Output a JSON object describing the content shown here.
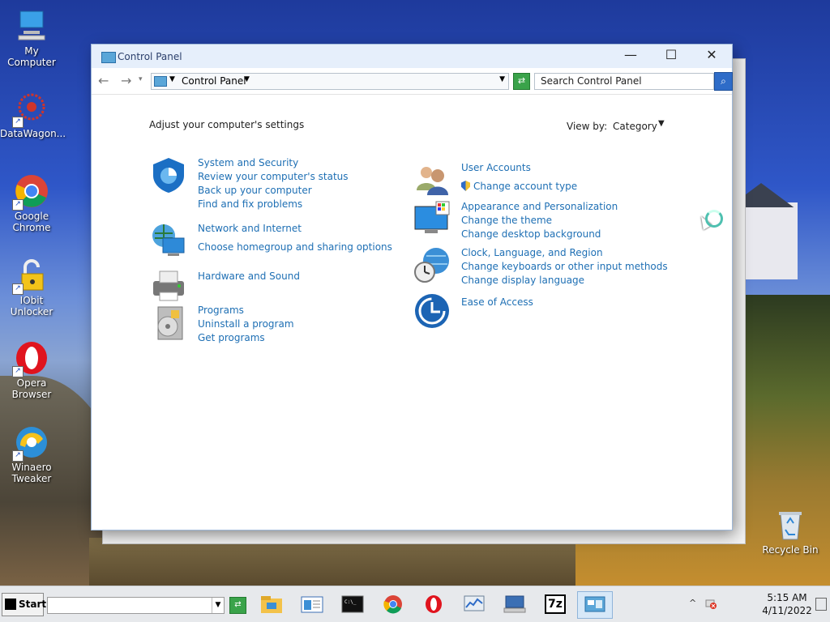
{
  "desktop": {
    "icons": [
      {
        "label": "My Computer",
        "icon": "computer-icon",
        "shortcut": false
      },
      {
        "label": "DataWagon...",
        "icon": "datawagon-icon",
        "shortcut": true
      },
      {
        "label": "Google Chrome",
        "icon": "chrome-icon",
        "shortcut": true
      },
      {
        "label": "IObit Unlocker",
        "icon": "lock-icon",
        "shortcut": true
      },
      {
        "label": "Opera Browser",
        "icon": "opera-icon",
        "shortcut": true
      },
      {
        "label": "Winaero Tweaker",
        "icon": "winaero-icon",
        "shortcut": true
      }
    ],
    "recycle_bin": "Recycle Bin"
  },
  "window": {
    "title": "Control Panel",
    "address": {
      "crumb": "Control Panel",
      "search_placeholder": "Search Control Panel"
    },
    "heading": "Adjust your computer's settings",
    "view_by_label": "View by:",
    "view_by_value": "Category",
    "categories_left": [
      {
        "title": "System and Security",
        "icon": "shield-icon",
        "links": [
          "Review your computer's status",
          "Back up your computer",
          "Find and fix problems"
        ]
      },
      {
        "title": "Network and Internet",
        "icon": "network-globe-icon",
        "links": [
          "Choose homegroup and sharing options"
        ]
      },
      {
        "title": "Hardware and Sound",
        "icon": "printer-icon",
        "links": []
      },
      {
        "title": "Programs",
        "icon": "programs-disc-icon",
        "links": [
          "Uninstall a program",
          "Get programs"
        ]
      }
    ],
    "categories_right": [
      {
        "title": "User Accounts",
        "icon": "users-icon",
        "links": [
          "Change account type"
        ]
      },
      {
        "title": "Appearance and Personalization",
        "icon": "monitor-palette-icon",
        "links": [
          "Change the theme",
          "Change desktop background"
        ]
      },
      {
        "title": "Clock, Language, and Region",
        "icon": "clock-globe-icon",
        "links": [
          "Change keyboards or other input methods",
          "Change display language"
        ]
      },
      {
        "title": "Ease of Access",
        "icon": "ease-of-access-icon",
        "links": []
      }
    ]
  },
  "taskbar": {
    "start_label": "Start",
    "apps": [
      "file-explorer-icon",
      "window-icon",
      "cmd-icon",
      "chrome-icon",
      "opera-icon",
      "task-manager-icon",
      "remote-desktop-icon",
      "7zip-icon",
      "control-panel-icon"
    ],
    "sevenzip_label": "7z",
    "tray_arrow": "^",
    "time": "5:15 AM",
    "date": "4/11/2022"
  },
  "colors": {
    "link": "#1e6fb4",
    "title_text": "#2b3f6b",
    "accent_green": "#3aa34a"
  }
}
